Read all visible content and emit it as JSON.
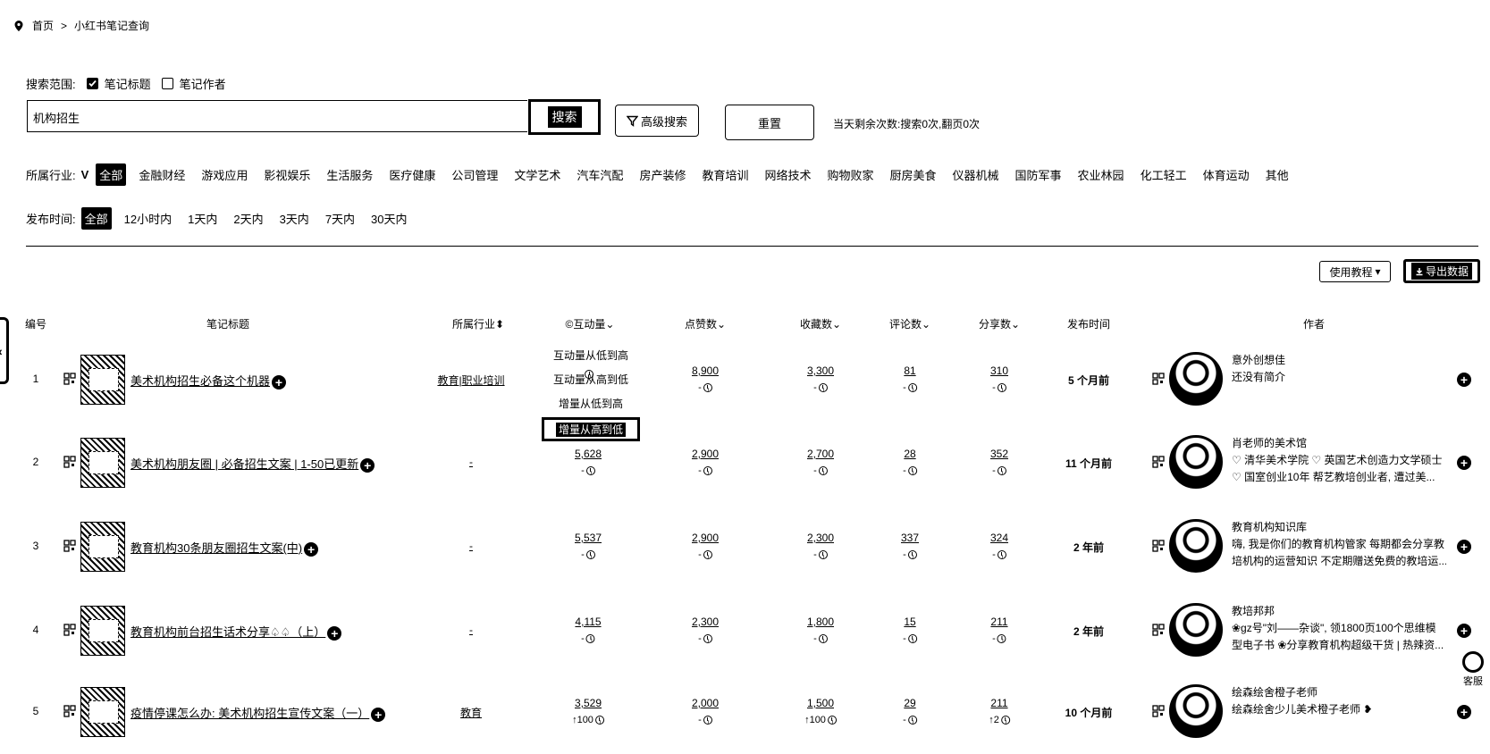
{
  "breadcrumb": {
    "home": "首页",
    "sep": ">",
    "current": "小红书笔记查询"
  },
  "scope": {
    "label": "搜索范围:",
    "option1": "笔记标题",
    "option2": "笔记作者"
  },
  "search": {
    "value": "机构招生",
    "button": "搜索",
    "advanced": "高级搜索",
    "reset": "重置",
    "quota": "当天剩余次数:搜索0次,翻页0次"
  },
  "industry": {
    "label": "所属行业:",
    "items": [
      "全部",
      "金融财经",
      "游戏应用",
      "影视娱乐",
      "生活服务",
      "医疗健康",
      "公司管理",
      "文学艺术",
      "汽车汽配",
      "房产装修",
      "教育培训",
      "网络技术",
      "购物败家",
      "厨房美食",
      "仪器机械",
      "国防军事",
      "农业林园",
      "化工轻工",
      "体育运动",
      "其他"
    ]
  },
  "time": {
    "label": "发布时间:",
    "items": [
      "全部",
      "12小时内",
      "1天内",
      "2天内",
      "3天内",
      "7天内",
      "30天内"
    ]
  },
  "toolbar": {
    "tutorial": "使用教程",
    "export": "导出数据"
  },
  "columns": {
    "no": "编号",
    "title": "笔记标题",
    "industry": "所属行业",
    "interact": "互动量",
    "likes": "点赞数",
    "collects": "收藏数",
    "comments": "评论数",
    "shares": "分享数",
    "time": "发布时间",
    "author": "作者"
  },
  "sort_menu": [
    "互动量从低到高",
    "互动量从高到低",
    "增量从低到高",
    "增量从高到低"
  ],
  "rows": [
    {
      "no": "1",
      "title": "美术机构招生必备这个机器",
      "industry": "教育|职业培训",
      "interact": "",
      "interact_sub": "",
      "likes": "8,900",
      "likes_sub": "-",
      "collects": "3,300",
      "collects_sub": "-",
      "comments": "81",
      "comments_sub": "-",
      "shares": "310",
      "shares_sub": "-",
      "time": "5 个月前",
      "author": "意外创想佳",
      "bio1": "还没有简介",
      "bio2": ""
    },
    {
      "no": "2",
      "title": "美术机构朋友圈 | 必备招生文案 | 1-50已更新",
      "industry": "-",
      "interact": "5,628",
      "interact_sub": "-",
      "likes": "2,900",
      "likes_sub": "-",
      "collects": "2,700",
      "collects_sub": "-",
      "comments": "28",
      "comments_sub": "-",
      "shares": "352",
      "shares_sub": "-",
      "time": "11 个月前",
      "author": "肖老师的美术馆",
      "bio1": "♡ 清华美术学院 ♡ 英国艺术创造力文学硕士",
      "bio2": "♡ 国室创业10年 帮艺教培创业者, 遭过美..."
    },
    {
      "no": "3",
      "title": "教育机构30条朋友圈招生文案(中)",
      "industry": "-",
      "interact": "5,537",
      "interact_sub": "-",
      "likes": "2,900",
      "likes_sub": "-",
      "collects": "2,300",
      "collects_sub": "-",
      "comments": "337",
      "comments_sub": "-",
      "shares": "324",
      "shares_sub": "-",
      "time": "2 年前",
      "author": "教育机构知识库",
      "bio1": "嗨, 我是你们的教育机构管家 每期都会分享教",
      "bio2": "培机构的运营知识 不定期赠送免费的教培运..."
    },
    {
      "no": "4",
      "title": "教育机构前台招生话术分享♤♤（上）",
      "industry": "-",
      "interact": "4,115",
      "interact_sub": "-",
      "likes": "2,300",
      "likes_sub": "-",
      "collects": "1,800",
      "collects_sub": "-",
      "comments": "15",
      "comments_sub": "-",
      "shares": "211",
      "shares_sub": "-",
      "time": "2 年前",
      "author": "教培邦邦",
      "bio1": "❀gz号\"刘——杂谈\", 领1800页100个思维模",
      "bio2": "型电子书 ❀分享教育机构超级干货 | 热辣资..."
    },
    {
      "no": "5",
      "title": "疫情停课怎么办: 美术机构招生宣传文案（一）",
      "industry": "教育",
      "interact": "3,529",
      "interact_sub": "↑100",
      "likes": "2,000",
      "likes_sub": "-",
      "collects": "1,500",
      "collects_sub": "↑100",
      "comments": "29",
      "comments_sub": "-",
      "shares": "211",
      "shares_sub": "↑2",
      "time": "10 个月前",
      "author": "绘森绘舍橙子老师",
      "bio1": "绘森绘舍少儿美术橙子老师 ❥",
      "bio2": ""
    }
  ],
  "service": "客服"
}
